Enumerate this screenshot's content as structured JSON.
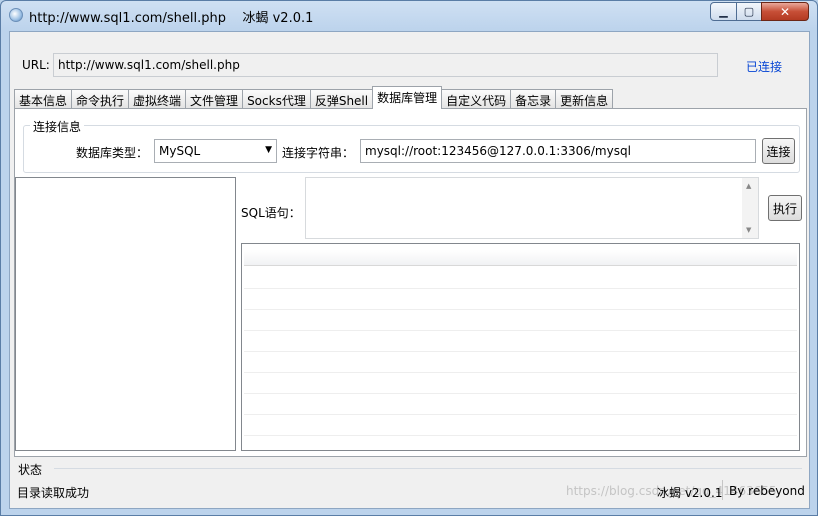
{
  "window": {
    "title": "http://www.sql1.com/shell.php    冰蝎 v2.0.1",
    "controls": {
      "minimize": "▁",
      "maximize": "▢",
      "close": "✕"
    }
  },
  "url_bar": {
    "label": "URL:",
    "value": "http://www.sql1.com/shell.php",
    "status": "已连接"
  },
  "tabs": [
    {
      "label": "基本信息"
    },
    {
      "label": "命令执行"
    },
    {
      "label": "虚拟终端"
    },
    {
      "label": "文件管理"
    },
    {
      "label": "Socks代理"
    },
    {
      "label": "反弹Shell"
    },
    {
      "label": "数据库管理",
      "active": true
    },
    {
      "label": "自定义代码"
    },
    {
      "label": "备忘录"
    },
    {
      "label": "更新信息"
    }
  ],
  "db": {
    "group_title": "连接信息",
    "type_label": "数据库类型：",
    "type_value": "MySQL",
    "conn_label": "连接字符串：",
    "conn_value": "mysql://root:123456@127.0.0.1:3306/mysql",
    "connect_button": "连接",
    "sql_label": "SQL语句：",
    "sql_value": "",
    "exec_button": "执行"
  },
  "status": {
    "title": "状态",
    "message": "目录读取成功",
    "version": "冰蝎 v2.0.1",
    "author": "By rebeyond",
    "watermark": "https://blog.csdn.net/qq_41463655"
  }
}
